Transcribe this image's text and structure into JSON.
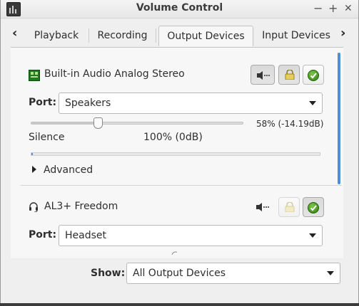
{
  "window": {
    "title": "Volume Control",
    "controls": {
      "minimize": "−",
      "maximize": "+",
      "close": "✕"
    }
  },
  "tabs": {
    "items": [
      {
        "label": "Playback",
        "active": false
      },
      {
        "label": "Recording",
        "active": false
      },
      {
        "label": "Output Devices",
        "active": true
      },
      {
        "label": "Input Devices",
        "active": false
      }
    ],
    "prev_arrow": "‹",
    "next_arrow": "›"
  },
  "devices": [
    {
      "name": "Built-in Audio Analog Stereo",
      "icon": "sound-card-icon",
      "muted": false,
      "locked": true,
      "default": true,
      "port_label": "Port:",
      "port_value": "Speakers",
      "volume_percent": 58,
      "volume_readout": "58% (-14.19dB)",
      "scale_left": "Silence",
      "scale_mid": "100% (0dB)",
      "advanced_label": "Advanced"
    },
    {
      "name": "AL3+ Freedom",
      "icon": "headset-icon",
      "muted": false,
      "locked": false,
      "default": true,
      "port_label": "Port:",
      "port_value": "Headset"
    }
  ],
  "footer": {
    "show_label": "Show:",
    "show_value": "All Output Devices"
  },
  "colors": {
    "accent": "#4a90d9",
    "default_check": "#3a8f1e",
    "lock": "#e7cf5a"
  }
}
